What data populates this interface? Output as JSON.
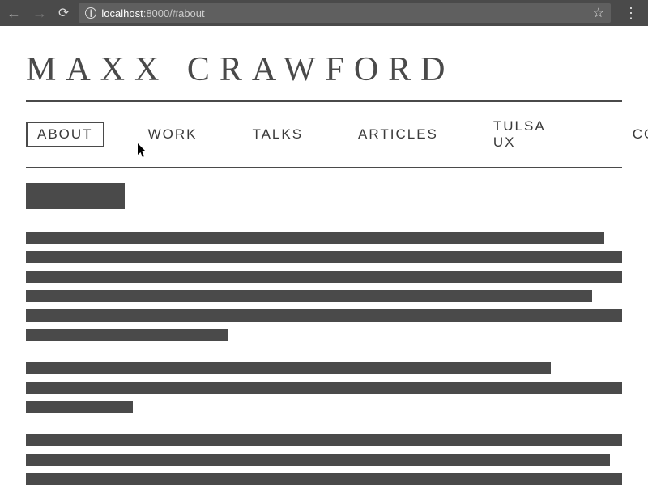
{
  "browser": {
    "url_prefix": "localhost",
    "url_suffix": ":8000/#about"
  },
  "header": {
    "title": "MAXX CRAWFORD"
  },
  "nav": {
    "items": [
      "ABOUT",
      "WORK",
      "TALKS",
      "ARTICLES",
      "TULSA UX"
    ],
    "contact": "CONTACT",
    "active_index": 0
  }
}
